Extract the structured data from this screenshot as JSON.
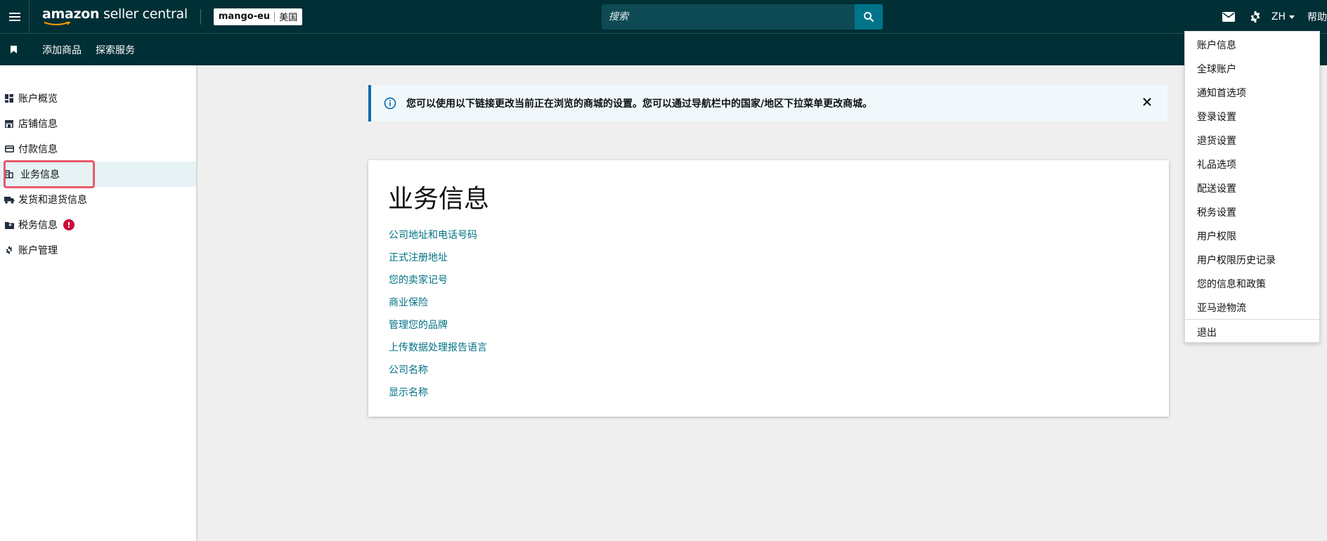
{
  "header": {
    "logo_brand": "amazon",
    "logo_product": "seller central",
    "store_name": "mango-eu",
    "store_region": "美国",
    "search_placeholder": "搜索",
    "language": "ZH",
    "help_label": "帮助"
  },
  "subnav": {
    "items": [
      "添加商品",
      "探索服务"
    ]
  },
  "sidebar": {
    "items": [
      {
        "label": "账户概览",
        "icon": "dashboard-icon"
      },
      {
        "label": "店铺信息",
        "icon": "store-icon"
      },
      {
        "label": "付款信息",
        "icon": "credit-card-icon"
      },
      {
        "label": "业务信息",
        "icon": "business-icon",
        "active": true
      },
      {
        "label": "发货和退货信息",
        "icon": "truck-icon"
      },
      {
        "label": "税务信息",
        "icon": "tax-folder-icon",
        "badge": "!"
      },
      {
        "label": "账户管理",
        "icon": "gear-icon"
      }
    ]
  },
  "banner": {
    "message": "您可以使用以下链接更改当前正在浏览的商城的设置。您可以通过导航栏中的国家/地区下拉菜单更改商城。"
  },
  "main": {
    "title": "业务信息",
    "links": [
      "公司地址和电话号码",
      "正式注册地址",
      "您的卖家记号",
      "商业保险",
      "管理您的品牌",
      "上传数据处理报告语言",
      "公司名称",
      "显示名称"
    ]
  },
  "settings_menu": {
    "items": [
      "账户信息",
      "全球账户",
      "通知首选项",
      "登录设置",
      "退货设置",
      "礼品选项",
      "配送设置",
      "税务设置",
      "用户权限",
      "用户权限历史记录",
      "您的信息和政策",
      "亚马逊物流"
    ],
    "logout": "退出"
  },
  "colors": {
    "header_bg": "#002f36",
    "link": "#007185",
    "highlight": "#e8596b",
    "badge": "#cc0c39",
    "banner_accent": "#0f6dab"
  }
}
